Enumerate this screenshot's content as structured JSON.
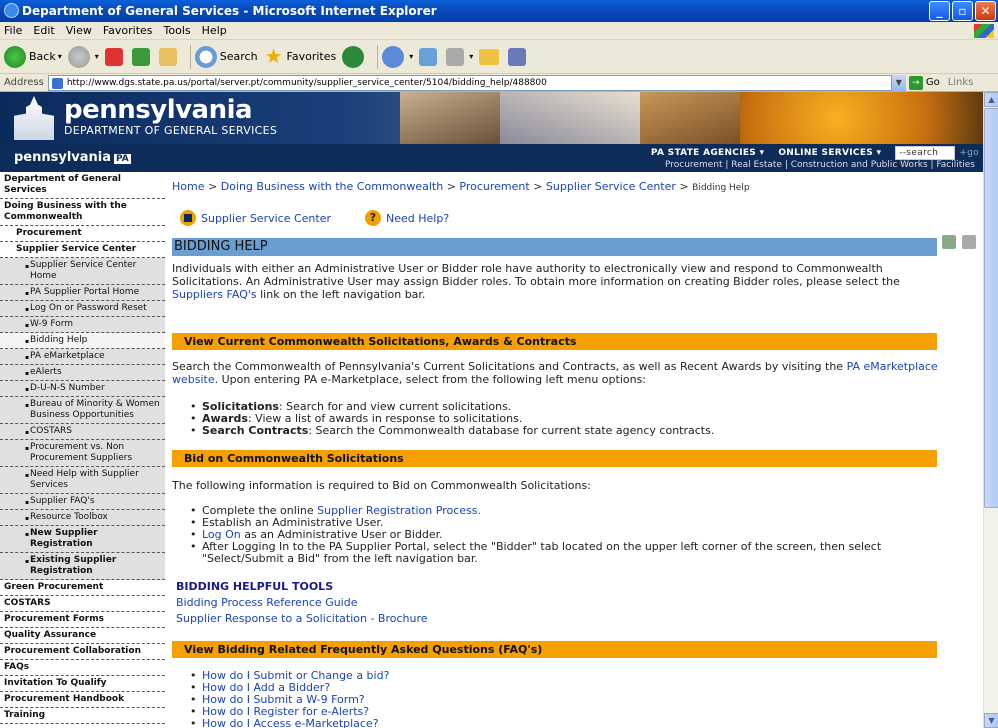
{
  "window": {
    "title": "Department of General Services - Microsoft Internet Explorer"
  },
  "menubar": [
    "File",
    "Edit",
    "View",
    "Favorites",
    "Tools",
    "Help"
  ],
  "toolbar": {
    "back": "Back",
    "search": "Search",
    "favorites": "Favorites"
  },
  "address": {
    "label": "Address",
    "url": "http://www.dgs.state.pa.us/portal/server.pt/community/supplier_service_center/5104/bidding_help/488800",
    "go": "Go",
    "links": "Links"
  },
  "banner": {
    "brand": "pennsylvania",
    "dept": "DEPARTMENT OF GENERAL SERVICES"
  },
  "subbar": {
    "pa": "pennsylvania",
    "flag": "PA",
    "nav1": "PA STATE AGENCIES",
    "nav2": "ONLINE SERVICES",
    "search_placeholder": "--search PA--",
    "go": "+go",
    "crumbs": "Procurement | Real Estate | Construction and Public Works | Facilities"
  },
  "leftnav": [
    {
      "label": "Department of General Services",
      "level": 1
    },
    {
      "label": "Doing Business with the Commonwealth",
      "level": 1
    },
    {
      "label": "Procurement",
      "level": 2
    },
    {
      "label": "Supplier Service Center",
      "level": 2
    },
    {
      "label": "Supplier Service Center Home",
      "level": 3
    },
    {
      "label": "PA Supplier Portal Home",
      "level": 3
    },
    {
      "label": "Log On or Password Reset",
      "level": 3
    },
    {
      "label": "W-9 Form",
      "level": 3
    },
    {
      "label": "Bidding Help",
      "level": 3,
      "active": true
    },
    {
      "label": "PA eMarketplace",
      "level": 3
    },
    {
      "label": "eAlerts",
      "level": 3
    },
    {
      "label": "D-U-N-S Number",
      "level": 3
    },
    {
      "label": "Bureau of Minority & Women Business Opportunities",
      "level": 3
    },
    {
      "label": "COSTARS",
      "level": 3
    },
    {
      "label": "Procurement vs. Non Procurement Suppliers",
      "level": 3
    },
    {
      "label": "Need Help with Supplier Services",
      "level": 3
    },
    {
      "label": "Supplier FAQ's",
      "level": 3
    },
    {
      "label": "Resource Toolbox",
      "level": 3
    },
    {
      "label": "New Supplier Registration",
      "level": 3,
      "bold": true
    },
    {
      "label": "Existing Supplier Registration",
      "level": 3,
      "bold": true
    },
    {
      "label": "Green Procurement",
      "level": 2
    },
    {
      "label": "COSTARS",
      "level": 2
    },
    {
      "label": "Procurement Forms",
      "level": 2
    },
    {
      "label": "Quality Assurance",
      "level": 2
    },
    {
      "label": "Procurement Collaboration",
      "level": 2
    },
    {
      "label": "FAQs",
      "level": 2
    },
    {
      "label": "Invitation To Qualify",
      "level": 2
    },
    {
      "label": "Procurement Handbook",
      "level": 2
    },
    {
      "label": "Training",
      "level": 2
    }
  ],
  "crumb": {
    "home": "Home",
    "c1": "Doing Business with the Commonwealth",
    "c2": "Procurement",
    "c3": "Supplier Service Center",
    "cur": "Bidding Help"
  },
  "quick": {
    "ssc": "Supplier Service Center",
    "help": "Need Help?"
  },
  "title": "BIDDING HELP",
  "intro": {
    "text": "Individuals with either an Administrative User or Bidder role have authority to electronically view and respond to Commonwealth Solicitations. An Administrative User may assign Bidder roles. To obtain more information on creating Bidder roles, please select the ",
    "link": "Suppliers FAQ's",
    "tail": " link on the left navigation bar."
  },
  "sec1": {
    "heading": "View Current Commonwealth Solicitations, Awards & Contracts",
    "text": "Search the Commonwealth of Pennsylvania's Current Solicitations and Contracts, as well as Recent Awards by visiting the ",
    "link": "PA eMarketplace website",
    "tail": ". Upon entering PA e-Marketplace, select from the following left menu options:",
    "items": [
      {
        "b": "Solicitations",
        "t": ": Search for and view current solicitations."
      },
      {
        "b": "Awards",
        "t": ": View a list of awards in response to solicitations."
      },
      {
        "b": "Search Contracts",
        "t": ": Search the Commonwealth database for current state agency contracts."
      }
    ]
  },
  "sec2": {
    "heading": "Bid on Commonwealth Solicitations",
    "text": "The following information is required to Bid on Commonwealth Solicitations:",
    "i1a": "Complete the online ",
    "i1link": "Supplier Registration Process.",
    "i2": "Establish an Administrative User.",
    "i3link": "Log On",
    "i3": " as an Administrative User or Bidder.",
    "i4": "After Logging In to the PA Supplier Portal, select the \"Bidder\" tab located on the upper left corner of the screen, then select \"Select/Submit a Bid\" from the left navigation bar."
  },
  "tools": {
    "heading": "BIDDING HELPFUL TOOLS",
    "l1": "Bidding Process Reference Guide",
    "l2": "Supplier Response to a Solicitation - Brochure"
  },
  "sec3": {
    "heading": "View Bidding Related Frequently Asked Questions (FAQ's)",
    "items": [
      "How do I Submit or Change a bid?",
      "How do I Add a Bidder?",
      "How do I Submit a W-9 Form?",
      "How do I Register for e-Alerts?",
      "How do I Access e-Marketplace?"
    ]
  }
}
